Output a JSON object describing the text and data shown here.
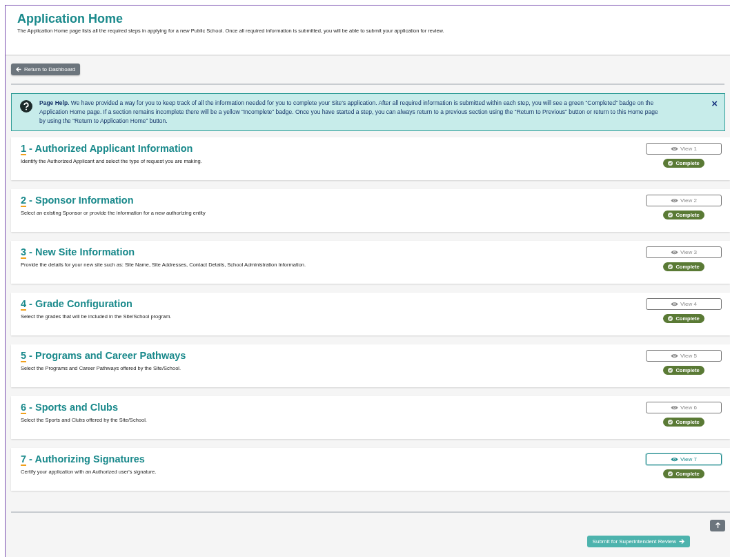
{
  "header": {
    "title": "Application Home",
    "description": "The Application Home page lists all the required steps in applying for a new Public School. Once all required information is submitted, you will be able to submit your application for review."
  },
  "return_button": "Return to Dashboard",
  "help": {
    "text": "**Page Help.** We have provided a way for you to keep track of all the information needed for you to complete your Site's application. After all required information is submitted within each step, you will see a green “Completed” badge on the Application Home page. If a section remains incomplete there will be a yellow “Incomplete” badge. Once you have started a step, you can always return to a previous section using the “Return to Previous” button or return to this Home page by using the “Return to Application Home” button.",
    "close": "×"
  },
  "steps": [
    {
      "number": "1",
      "title": " - Authorized Applicant Information",
      "description": "Identify the Authorized Applicant and select the type of request you are making.",
      "button": "View 1",
      "focused": false,
      "status": "Complete",
      "kind": "complete"
    },
    {
      "number": "2",
      "title": " - Sponsor Information",
      "description": "Select an existing Sponsor or provide the information for a new authorizing entity",
      "button": "View 2",
      "focused": false,
      "status": "Complete",
      "kind": "complete"
    },
    {
      "number": "3",
      "title": " - New Site Information",
      "description": "Provide the details for your new site such as: Site Name, Site Addresses, Contact Details, School Administration Information.",
      "button": "View 3",
      "focused": false,
      "status": "Complete",
      "kind": "complete"
    },
    {
      "number": "4",
      "title": " - Grade Configuration",
      "description": "Select the grades that will be included in the Site/School program.",
      "button": "View 4",
      "focused": false,
      "status": "Complete",
      "kind": "complete"
    },
    {
      "number": "5",
      "title": " - Programs and Career Pathways",
      "description": "Select the Programs and Career Pathways offered by the Site/School.",
      "button": "View 5",
      "focused": false,
      "status": "Complete",
      "kind": "complete"
    },
    {
      "number": "6",
      "title": " - Sports and Clubs",
      "description": "Select the Sports and Clubs offered by the Site/School.",
      "button": "View 6",
      "focused": false,
      "status": "Complete",
      "kind": "complete"
    },
    {
      "number": "7",
      "title": " - Authorizing Signatures",
      "description": "Certify your application with an Authorized user's signature.",
      "button": "View 7",
      "focused": true,
      "status": "Complete",
      "kind": "complete"
    }
  ],
  "submit_button": "Submit for Superintendent Review"
}
